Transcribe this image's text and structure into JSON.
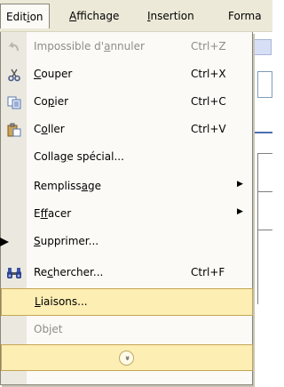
{
  "menubar": {
    "items": [
      {
        "label_pre": "Edit",
        "mnemonic": "i",
        "label_post": "on"
      },
      {
        "label_pre": "",
        "mnemonic": "A",
        "label_post": "ffichage"
      },
      {
        "label_pre": "",
        "mnemonic": "I",
        "label_post": "nsertion"
      },
      {
        "label_pre": "Forma",
        "mnemonic": "",
        "label_post": ""
      }
    ]
  },
  "menu": {
    "items": [
      {
        "icon": "undo-icon",
        "pre": "Impossible d'",
        "mn": "a",
        "post": "nnuler",
        "shortcut": "Ctrl+Z",
        "disabled": true
      },
      {
        "icon": "scissors-icon",
        "pre": "",
        "mn": "C",
        "post": "ouper",
        "shortcut": "Ctrl+X"
      },
      {
        "icon": "copy-icon",
        "pre": "Co",
        "mn": "p",
        "post": "ier",
        "shortcut": "Ctrl+C"
      },
      {
        "icon": "paste-icon",
        "pre": "C",
        "mn": "o",
        "post": "ller",
        "shortcut": "Ctrl+V"
      },
      {
        "icon": "",
        "pre": "Colla",
        "mn": "g",
        "post": "e spécial...",
        "shortcut": ""
      },
      {
        "icon": "",
        "pre": "Rempliss",
        "mn": "a",
        "post": "ge",
        "shortcut": "",
        "submenu": true
      },
      {
        "icon": "",
        "pre": "E",
        "mn": "f",
        "post": "facer",
        "shortcut": "",
        "submenu": true
      },
      {
        "icon": "",
        "pre": "",
        "mn": "S",
        "post": "upprimer...",
        "shortcut": ""
      },
      {
        "icon": "binoculars-icon",
        "pre": "Re",
        "mn": "c",
        "post": "hercher...",
        "shortcut": "Ctrl+F"
      },
      {
        "icon": "",
        "pre": "",
        "mn": "L",
        "post": "iaisons...",
        "shortcut": "",
        "highlight": true
      },
      {
        "icon": "",
        "pre": "Ob",
        "mn": "j",
        "post": "et",
        "shortcut": "",
        "disabled": true
      }
    ],
    "expand_glyph": "»"
  },
  "colors": {
    "menubar_bg": "#ece9d8",
    "menu_bg": "#fbfaf6",
    "gutter_bg": "#ebe8df",
    "highlight_bg": "#fdeeb3",
    "highlight_border": "#c4a653"
  }
}
